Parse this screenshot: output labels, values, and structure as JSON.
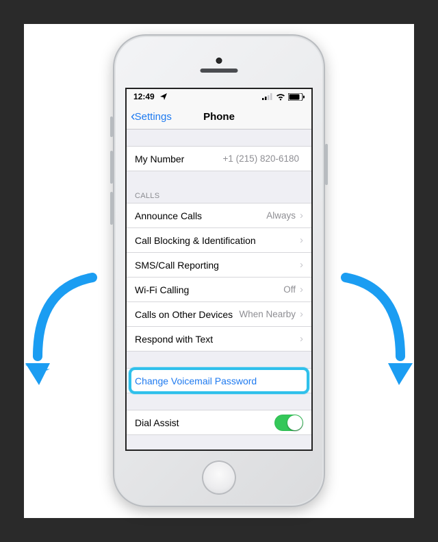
{
  "status": {
    "time": "12:49"
  },
  "nav": {
    "back_label": "Settings",
    "title": "Phone"
  },
  "my_number": {
    "label": "My Number",
    "value": "+1 (215) 820-6180"
  },
  "calls": {
    "header": "CALLS",
    "announce": {
      "label": "Announce Calls",
      "value": "Always"
    },
    "blocking": {
      "label": "Call Blocking & Identification",
      "value": ""
    },
    "sms": {
      "label": "SMS/Call Reporting",
      "value": ""
    },
    "wifi": {
      "label": "Wi-Fi Calling",
      "value": "Off"
    },
    "other": {
      "label": "Calls on Other Devices",
      "value": "When Nearby"
    },
    "respond": {
      "label": "Respond with Text",
      "value": ""
    }
  },
  "voicemail": {
    "label": "Change Voicemail Password"
  },
  "dial_assist": {
    "label": "Dial Assist",
    "enabled": true
  }
}
